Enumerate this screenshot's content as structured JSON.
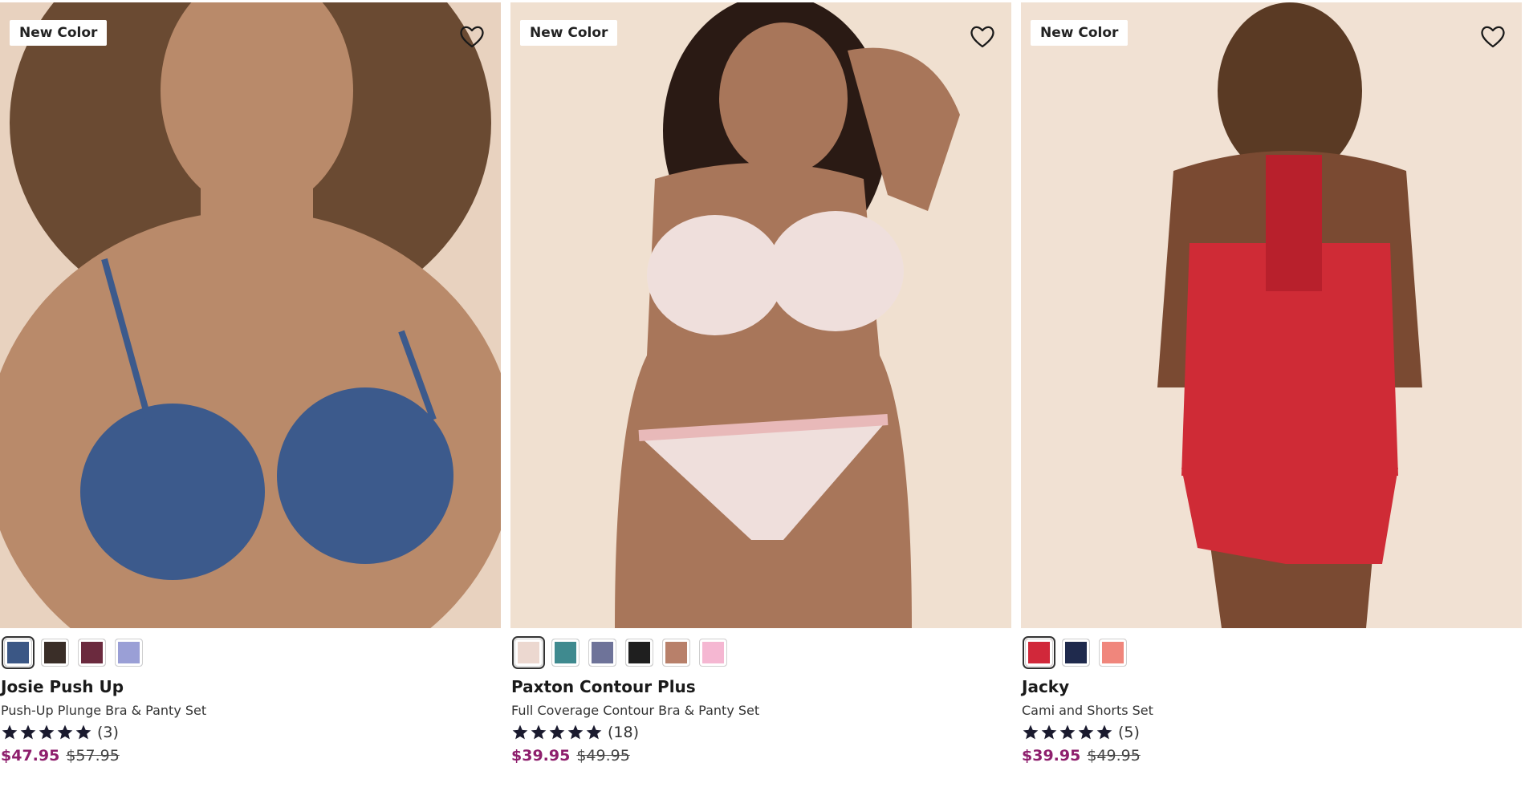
{
  "products": [
    {
      "badge": "New Color",
      "name": "Josie Push Up",
      "description": "Push-Up Plunge Bra & Panty Set",
      "rating": 5,
      "review_count": "(3)",
      "sale_price": "$47.95",
      "original_price": "$57.95",
      "swatches": [
        "#3b5785",
        "#3a2e28",
        "#6b2a3e",
        "#9a9fd6"
      ],
      "selected_swatch": 0,
      "photo": {
        "bg": "#e8d2bf",
        "skin": "#b98a6a",
        "garment": "#3c5a8c",
        "hair": "#6a4a32"
      }
    },
    {
      "badge": "New Color",
      "name": "Paxton Contour Plus",
      "description": "Full Coverage Contour Bra & Panty Set",
      "rating": 5,
      "review_count": "(18)",
      "sale_price": "$39.95",
      "original_price": "$49.95",
      "swatches": [
        "#ecd8d0",
        "#3f8a8f",
        "#6e7399",
        "#1f1f1f",
        "#b8806a",
        "#f5b7d2"
      ],
      "selected_swatch": 0,
      "photo": {
        "bg": "#f0e0d0",
        "skin": "#a8765a",
        "garment": "#efdfdc",
        "hair": "#2a1a14"
      }
    },
    {
      "badge": "New Color",
      "name": "Jacky",
      "description": "Cami and Shorts Set",
      "rating": 5,
      "review_count": "(5)",
      "sale_price": "$39.95",
      "original_price": "$49.95",
      "swatches": [
        "#d1283a",
        "#1f2a4d",
        "#f0867c"
      ],
      "selected_swatch": 0,
      "photo": {
        "bg": "#f1e1d3",
        "skin": "#7a4a32",
        "garment": "#cf2b36",
        "hair": "#5a3a24"
      }
    }
  ],
  "icons": {
    "favorite": "heart-outline-icon",
    "star": "star-filled-icon"
  },
  "colors": {
    "sale_price": "#8e1f6d",
    "star": "#1a1a2e"
  }
}
